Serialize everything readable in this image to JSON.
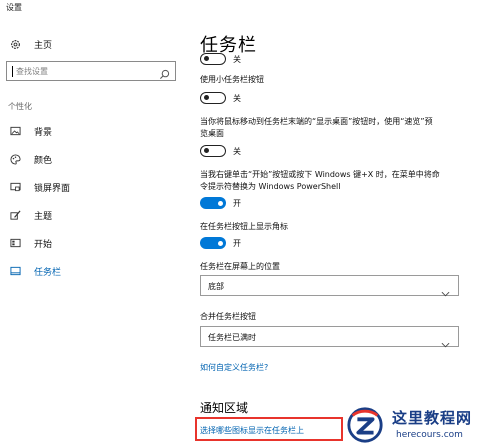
{
  "window": {
    "title": "设置"
  },
  "sidebar": {
    "home_label": "主页",
    "search_placeholder": "查找设置",
    "section_label": "个性化",
    "items": [
      {
        "label": "背景",
        "icon": "picture-icon"
      },
      {
        "label": "颜色",
        "icon": "palette-icon"
      },
      {
        "label": "锁屏界面",
        "icon": "lock-screen-icon"
      },
      {
        "label": "主题",
        "icon": "brush-icon"
      },
      {
        "label": "开始",
        "icon": "start-icon"
      },
      {
        "label": "任务栏",
        "icon": "taskbar-icon",
        "active": true
      }
    ]
  },
  "main": {
    "title": "任务栏",
    "partial_toggle": {
      "state": "关"
    },
    "small_buttons": {
      "label": "使用小任务栏按钮",
      "state": "关"
    },
    "peek": {
      "label_line1": "当你将鼠标移动到任务栏末端的“显示桌面”按钮时，使用“速览”预",
      "label_line2": "览桌面",
      "state": "关"
    },
    "powershell": {
      "label_line1": "当我右键单击“开始”按钮或按下 Windows 键+X 时，在菜单中将命",
      "label_line2": "令提示符替换为 Windows PowerShell",
      "state": "开"
    },
    "badges": {
      "label": "在任务栏按钮上显示角标",
      "state": "开"
    },
    "location": {
      "label": "任务栏在屏幕上的位置",
      "value": "底部"
    },
    "combine": {
      "label": "合并任务栏按钮",
      "value": "任务栏已满时"
    },
    "customize_link": "如何自定义任务栏?",
    "notification_heading": "通知区域",
    "notification_link": "选择哪些图标显示在任务栏上"
  },
  "watermark": {
    "text": "这里教程网",
    "url": "herecours.com"
  },
  "colors": {
    "accent": "#0078d7",
    "link": "#0063b1",
    "highlight": "#e8342c"
  }
}
